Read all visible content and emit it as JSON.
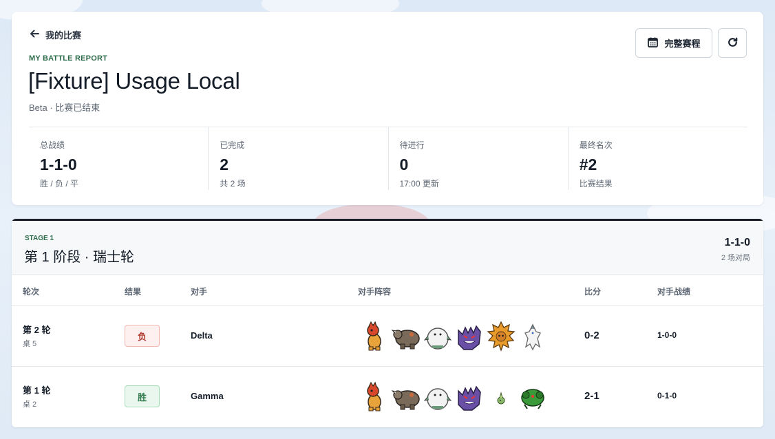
{
  "header": {
    "back_label": "我的比赛",
    "eyebrow": "MY BATTLE REPORT",
    "title": "[Fixture] Usage Local",
    "subtitle": "Beta · 比赛已结束",
    "schedule_button": "完整赛程"
  },
  "stats": [
    {
      "label": "总战绩",
      "value": "1-1-0",
      "sub": "胜 / 负 / 平"
    },
    {
      "label": "已完成",
      "value": "2",
      "sub": "共 2 场"
    },
    {
      "label": "待进行",
      "value": "0",
      "sub": "17:00 更新"
    },
    {
      "label": "最终名次",
      "value": "#2",
      "sub": "比赛结果"
    }
  ],
  "stage": {
    "eyebrow": "STAGE 1",
    "title": "第 1 阶段 · 瑞士轮",
    "record": "1-1-0",
    "matches": "2 场对局",
    "columns": {
      "round": "轮次",
      "result": "结果",
      "opponent": "对手",
      "team": "对手阵容",
      "score": "比分",
      "opp_record": "对手战绩"
    },
    "rows": [
      {
        "round": "第 2 轮",
        "table": "桌 5",
        "result": "负",
        "result_type": "loss",
        "opponent": "Delta",
        "team": [
          "scrafty-icon",
          "rhyperior-icon",
          "abomasnow-icon",
          "gengar-icon",
          "solrock-icon",
          "reshiram-icon"
        ],
        "score": "0-2",
        "opp_record": "1-0-0"
      },
      {
        "round": "第 1 轮",
        "table": "桌 2",
        "result": "胜",
        "result_type": "win",
        "opponent": "Gamma",
        "team": [
          "scrafty-icon",
          "rhyperior-icon",
          "abomasnow-icon",
          "gengar-icon",
          "budew-icon",
          "scizor-green-icon"
        ],
        "score": "2-1",
        "opp_record": "0-1-0"
      }
    ]
  },
  "colors": {
    "accent_green": "#2e6b4a",
    "loss_red": "#b03a2e",
    "win_green": "#2e7a4b",
    "stage_bar": "#1a1f27"
  }
}
